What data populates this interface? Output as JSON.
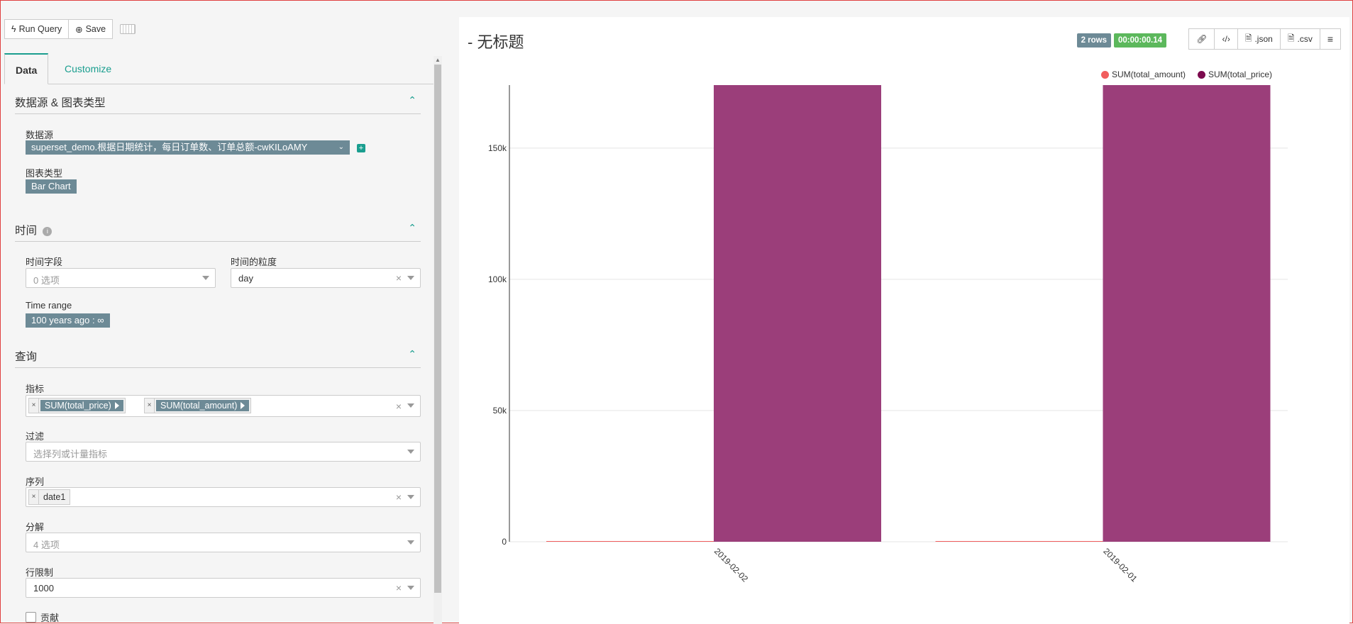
{
  "toolbar": {
    "run_query_label": "Run Query",
    "save_label": "Save"
  },
  "tabs": [
    {
      "label": "Data"
    },
    {
      "label": "Customize"
    }
  ],
  "sections": {
    "datasource": {
      "title": "数据源 & 图表类型",
      "datasource_label": "数据源",
      "datasource_value": "superset_demo.根据日期统计，每日订单数、订单总额-cwKILoAMY",
      "viz_type_label": "图表类型",
      "viz_type_value": "Bar Chart"
    },
    "time": {
      "title": "时间",
      "time_column_label": "时间字段",
      "time_column_placeholder": "0 选项",
      "time_grain_label": "时间的粒度",
      "time_grain_value": "day",
      "time_range_label": "Time range",
      "time_range_value": "100 years ago : ∞"
    },
    "query": {
      "title": "查询",
      "metrics_label": "指标",
      "metrics": [
        "SUM(total_price)",
        "SUM(total_amount)"
      ],
      "filters_label": "过滤",
      "filters_placeholder": "选择列或计量指标",
      "series_label": "序列",
      "series_value": "date1",
      "breakdowns_label": "分解",
      "breakdowns_placeholder": "4 选项",
      "row_limit_label": "行限制",
      "row_limit_value": "1000",
      "contribution_label": "贡献"
    }
  },
  "chart_header": {
    "title": "- 无标题",
    "rows_badge": "2 rows",
    "time_badge": "00:00:00.14",
    "json_label": ".json",
    "csv_label": ".csv"
  },
  "colors": {
    "accent": "#1a9e8f",
    "series_amount": "#f15d5d",
    "series_price": "#7c0a4e",
    "bar_fill": "#9b3e7a",
    "time_badge": "#5cb85c",
    "rows_badge": "#6d8a96"
  },
  "chart_data": {
    "type": "bar",
    "categories": [
      "2019-02-02",
      "2019-02-01"
    ],
    "series": [
      {
        "name": "SUM(total_amount)",
        "values": [
          40,
          40
        ]
      },
      {
        "name": "SUM(total_price)",
        "values": [
          174000,
          174000
        ]
      }
    ],
    "yticks": [
      "0",
      "50k",
      "100k",
      "150k"
    ],
    "ylim": [
      0,
      174000
    ],
    "legend": "top-right",
    "grid": true
  }
}
